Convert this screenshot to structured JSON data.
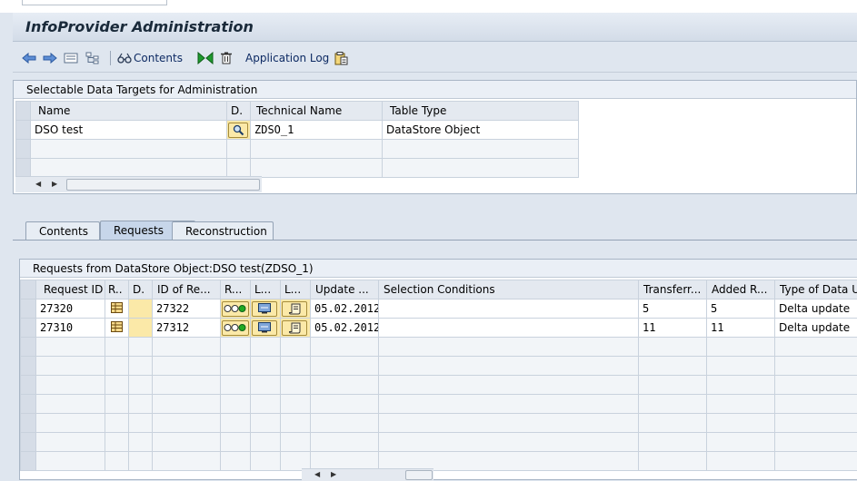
{
  "window": {
    "title": "InfoProvider Administration"
  },
  "toolbar": {
    "contents_label": "Contents",
    "app_log_label": "Application Log"
  },
  "targets": {
    "header": "Selectable Data Targets for Administration",
    "columns": [
      "Name",
      "D.",
      "Technical Name",
      "Table Type"
    ],
    "rows": [
      {
        "name": "DSO test",
        "technical_name": "ZDSO_1",
        "table_type": "DataStore Object"
      }
    ]
  },
  "tabs": [
    "Contents",
    "Requests",
    "Reconstruction"
  ],
  "active_tab": "Requests",
  "requests": {
    "header": "Requests from DataStore Object:DSO test(ZDSO_1)",
    "columns": [
      "Request ID",
      "R..",
      "D.",
      "ID of Re...",
      "R...",
      "L...",
      "L...",
      "Update ...",
      "Selection Conditions",
      "Transferr...",
      "Added R...",
      "Type of Data Up"
    ],
    "rows": [
      {
        "request_id": "27320",
        "id_of_re": "27322",
        "update": "05.02.2012",
        "transferred": "5",
        "added": "5",
        "type": "Delta update"
      },
      {
        "request_id": "27310",
        "id_of_re": "27312",
        "update": "05.02.2012",
        "transferred": "11",
        "added": "11",
        "type": "Delta update"
      }
    ]
  },
  "colors": {
    "status_green": "#22aa22",
    "button_yellow": "#fbe9a8",
    "tab_active": "#c7d6ea"
  }
}
